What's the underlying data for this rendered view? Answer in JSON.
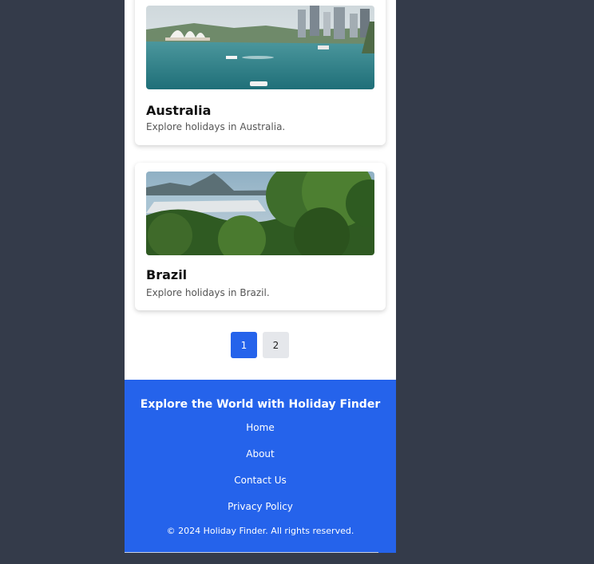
{
  "cards": [
    {
      "title": "Australia",
      "description": "Explore holidays in Australia.",
      "image": "sydney-harbour-photo"
    },
    {
      "title": "Brazil",
      "description": "Explore holidays in Brazil.",
      "image": "rio-de-janeiro-photo"
    }
  ],
  "pagination": {
    "pages": [
      "1",
      "2"
    ],
    "current": "1"
  },
  "footer": {
    "title": "Explore the World with Holiday Finder",
    "links": [
      "Home",
      "About",
      "Contact Us",
      "Privacy Policy"
    ],
    "copyright": "© 2024 Holiday Finder. All rights reserved."
  },
  "colors": {
    "accent": "#2563eb",
    "page_bg": "#343b4a"
  }
}
